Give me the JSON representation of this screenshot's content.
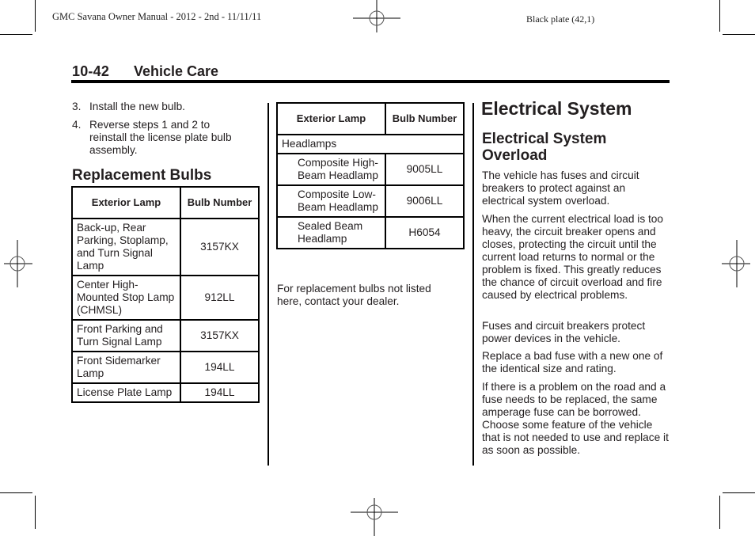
{
  "print_header": {
    "left": "GMC Savana Owner Manual - 2012 - 2nd - 11/11/11",
    "right": "Black plate (42,1)"
  },
  "page_header": {
    "page_number": "10-42",
    "section": "Vehicle Care"
  },
  "left_column": {
    "steps": [
      {
        "number": "3.",
        "text": "Install the new bulb."
      },
      {
        "number": "4.",
        "text": "Reverse steps 1 and 2 to reinstall the license plate bulb assembly."
      }
    ],
    "heading": "Replacement Bulbs",
    "table": {
      "headers": [
        "Exterior Lamp",
        "Bulb Number"
      ],
      "rows": [
        {
          "lamp": "Back-up, Rear Parking, Stoplamp, and Turn Signal Lamp",
          "bulb": "3157KX"
        },
        {
          "lamp": "Center High-Mounted Stop Lamp (CHMSL)",
          "bulb": "912LL"
        },
        {
          "lamp": "Front Parking and Turn Signal Lamp",
          "bulb": "3157KX"
        },
        {
          "lamp": "Front Sidemarker Lamp",
          "bulb": "194LL"
        },
        {
          "lamp": "License Plate Lamp",
          "bulb": "194LL"
        }
      ]
    }
  },
  "middle_column": {
    "table": {
      "headers": [
        "Exterior Lamp",
        "Bulb Number"
      ],
      "group_label": "Headlamps",
      "rows": [
        {
          "lamp": "Composite High-Beam Headlamp",
          "bulb": "9005LL"
        },
        {
          "lamp": "Composite Low-Beam Headlamp",
          "bulb": "9006LL"
        },
        {
          "lamp": "Sealed Beam Headlamp",
          "bulb": "H6054"
        }
      ]
    },
    "note": "For replacement bulbs not listed here, contact your dealer."
  },
  "right_column": {
    "title": "Electrical System",
    "subtitle": "Electrical System Overload",
    "paragraphs": [
      "The vehicle has fuses and circuit breakers to protect against an electrical system overload.",
      "When the current electrical load is too heavy, the circuit breaker opens and closes, protecting the circuit until the current load returns to normal or the problem is fixed. This greatly reduces the chance of circuit overload and fire caused by electrical problems.",
      "Fuses and circuit breakers protect power devices in the vehicle.",
      "Replace a bad fuse with a new one of the identical size and rating.",
      "If there is a problem on the road and a fuse needs to be replaced, the same amperage fuse can be borrowed. Choose some feature of the vehicle that is not needed to use and replace it as soon as possible."
    ]
  }
}
